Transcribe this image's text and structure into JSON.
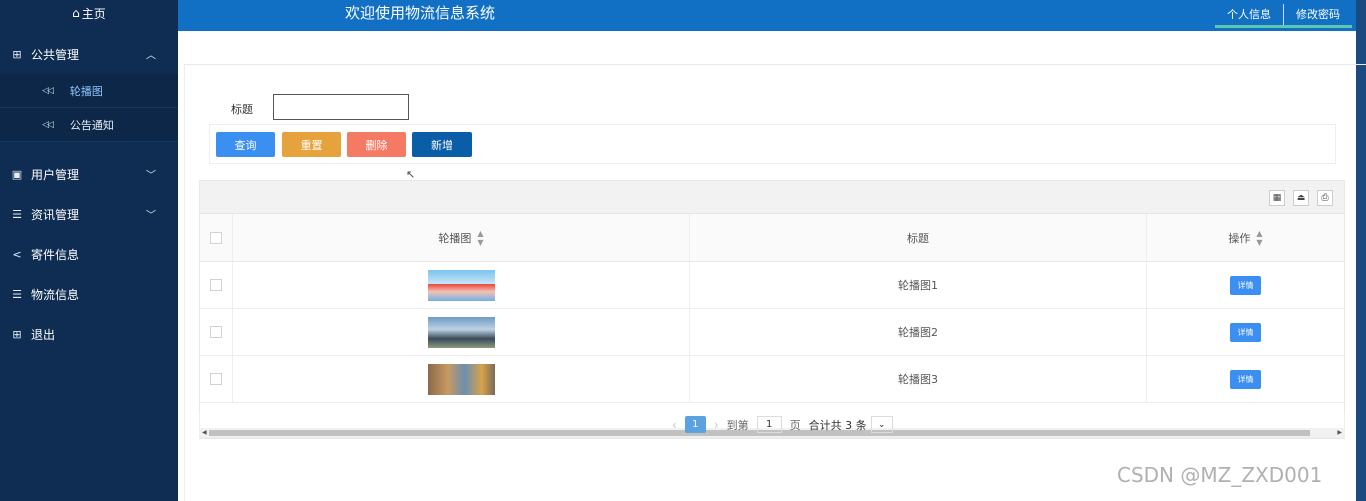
{
  "sidebar": {
    "home_label": "主页",
    "home_icon": "home-icon",
    "menus": [
      {
        "label": "公共管理",
        "icon": "grid-icon",
        "caret": "chevron-up-icon"
      },
      {
        "label": "用户管理",
        "icon": "book-icon",
        "caret": "chevron-down-icon"
      },
      {
        "label": "资讯管理",
        "icon": "list-icon",
        "caret": "chevron-down-icon"
      },
      {
        "label": "寄件信息",
        "icon": "share-icon"
      },
      {
        "label": "物流信息",
        "icon": "list-icon"
      },
      {
        "label": "退出",
        "icon": "grid-icon"
      }
    ],
    "submenu": [
      {
        "label": "轮播图",
        "active": true
      },
      {
        "label": "公告通知",
        "active": false
      }
    ]
  },
  "header": {
    "title": "欢迎使用物流信息系统",
    "links": [
      "个人信息",
      "修改密码"
    ]
  },
  "search": {
    "label": "标题",
    "value": ""
  },
  "buttons": {
    "query": "查询",
    "reset": "重置",
    "delete": "删除",
    "add": "新增"
  },
  "table": {
    "columns": [
      "轮播图",
      "标题",
      "操作"
    ],
    "rows": [
      {
        "title": "轮播图1",
        "action": "详情"
      },
      {
        "title": "轮播图2",
        "action": "详情"
      },
      {
        "title": "轮播图3",
        "action": "详情"
      }
    ]
  },
  "pagination": {
    "current_page": "1",
    "goto_label": "到第",
    "page_input": "1",
    "page_label": "页",
    "total_text": "合计共 3 条"
  },
  "watermark": "CSDN @MZ_ZXD001",
  "colors": {
    "sidebar_bg": "#0f2d52",
    "header_bg": "#1170c4",
    "query": "#3a8ff0",
    "reset": "#e6a23c",
    "delete": "#f47a63",
    "add": "#0a5ea8"
  }
}
